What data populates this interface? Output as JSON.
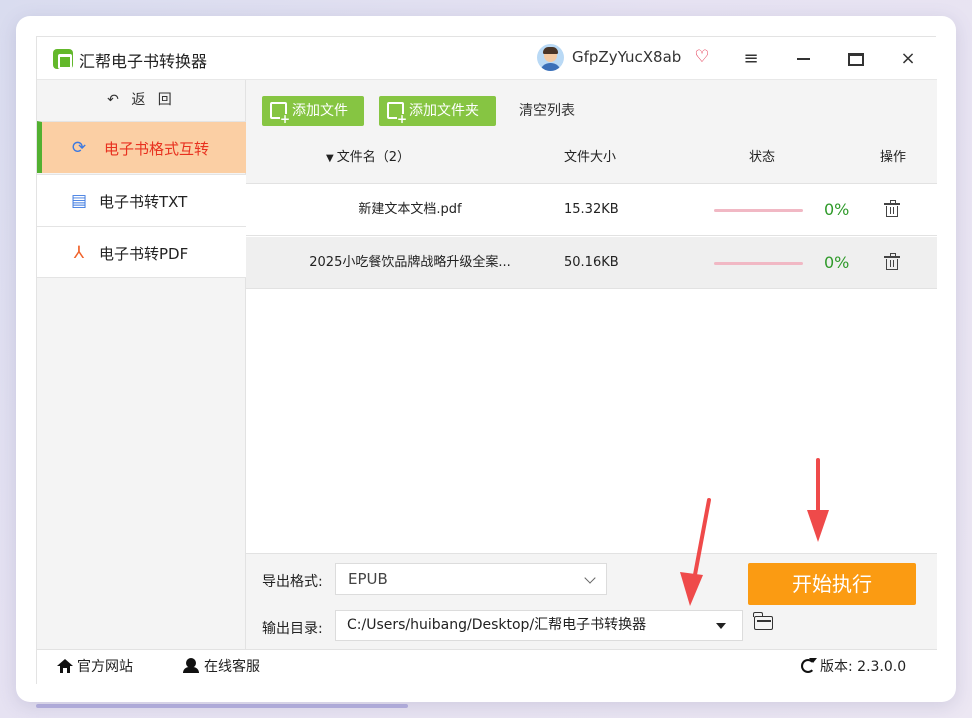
{
  "app": {
    "title": "汇帮电子书转换器",
    "username": "GfpZyYucX8ab",
    "menu_glyph": "≡",
    "close_glyph": "×",
    "vip_glyph": "♡"
  },
  "sidebar": {
    "back_label": "↶ 返 回",
    "items": [
      {
        "label": "电子书格式互转",
        "icon": "refresh-icon",
        "glyph": "⟳",
        "active": true
      },
      {
        "label": "电子书转TXT",
        "icon": "document-icon",
        "glyph": "▤",
        "active": false
      },
      {
        "label": "电子书转PDF",
        "icon": "pdf-icon",
        "glyph": "⅄",
        "active": false
      }
    ]
  },
  "toolbar": {
    "add_file_label": "添加文件",
    "add_folder_label": "添加文件夹",
    "clear_label": "清空列表"
  },
  "table": {
    "headers": {
      "sort_arrow": "▼",
      "name": "文件名（2）",
      "size": "文件大小",
      "status": "状态",
      "operation": "操作"
    },
    "rows": [
      {
        "name": "新建文本文档.pdf",
        "size": "15.32KB",
        "progress": 0,
        "progress_label": "0%"
      },
      {
        "name": "2025小吃餐饮品牌战略升级全案...",
        "size": "50.16KB",
        "progress": 0,
        "progress_label": "0%"
      }
    ]
  },
  "settings": {
    "format_label": "导出格式:",
    "format_value": "EPUB",
    "dir_label": "输出目录:",
    "dir_value": "C:/Users/huibang/Desktop/汇帮电子书转换器",
    "start_label": "开始执行"
  },
  "footer": {
    "official_site": "官方网站",
    "support": "在线客服",
    "version": "版本:  2.3.0.0"
  },
  "colors": {
    "accent_green": "#86c542",
    "active_nav_bg": "#fbcfa4",
    "active_nav_text": "#e8311f",
    "start_button": "#fb9b12",
    "progress_percent": "#2f9a2a",
    "annotation_arrow": "#ef4a4a"
  }
}
